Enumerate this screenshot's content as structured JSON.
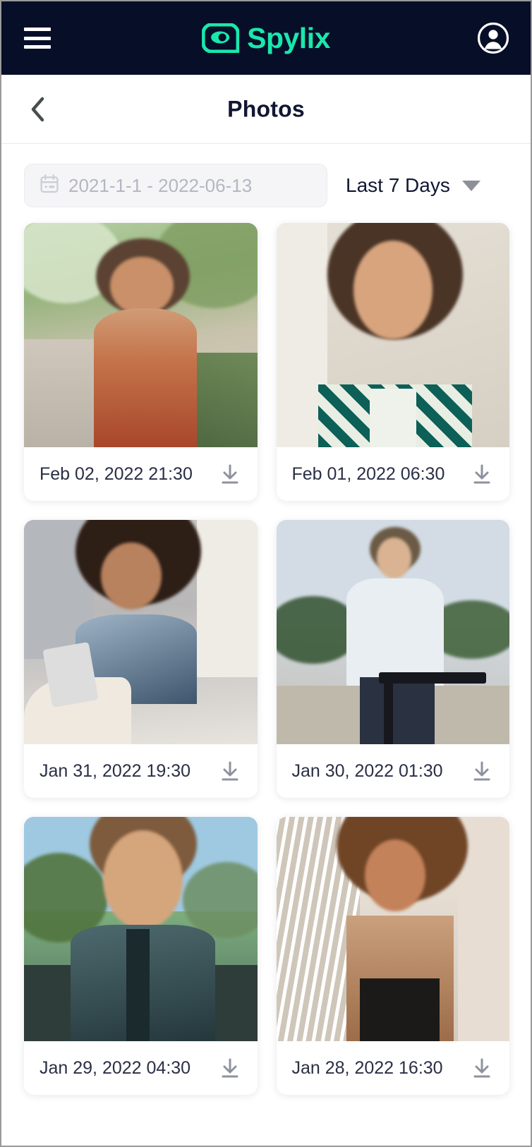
{
  "appbar": {
    "menu_icon": "hamburger-menu-icon",
    "brand_name": "Spylix",
    "brand_mark_icon": "spylix-eye-logo-icon",
    "account_icon": "account-circle-icon",
    "background_color": "#070E28",
    "brand_color": "#19E8AC"
  },
  "titlebar": {
    "back_icon": "chevron-left-icon",
    "title": "Photos"
  },
  "filters": {
    "date_range": {
      "calendar_icon": "calendar-icon",
      "placeholder": "2021-1-1 - 2022-06-13",
      "value": ""
    },
    "preset": {
      "label": "Last 7 Days",
      "caret_icon": "caret-down-icon"
    }
  },
  "photos": [
    {
      "date": "Feb 02, 2022 21:30",
      "alt": "smiling-woman-curly-hair-outdoors",
      "download_icon": "download-icon"
    },
    {
      "date": "Feb 01, 2022 06:30",
      "alt": "smiling-woman-patterned-collar-shirt",
      "download_icon": "download-icon"
    },
    {
      "date": "Jan 31, 2022 19:30",
      "alt": "woman-in-bed-using-phone",
      "download_icon": "download-icon"
    },
    {
      "date": "Jan 30, 2022 01:30",
      "alt": "young-man-sitting-with-bmx-bike",
      "download_icon": "download-icon"
    },
    {
      "date": "Jan 29, 2022 04:30",
      "alt": "young-man-portrait-outdoors",
      "download_icon": "download-icon"
    },
    {
      "date": "Jan 28, 2022 16:30",
      "alt": "laughing-woman-hands-on-face",
      "download_icon": "download-icon"
    }
  ]
}
